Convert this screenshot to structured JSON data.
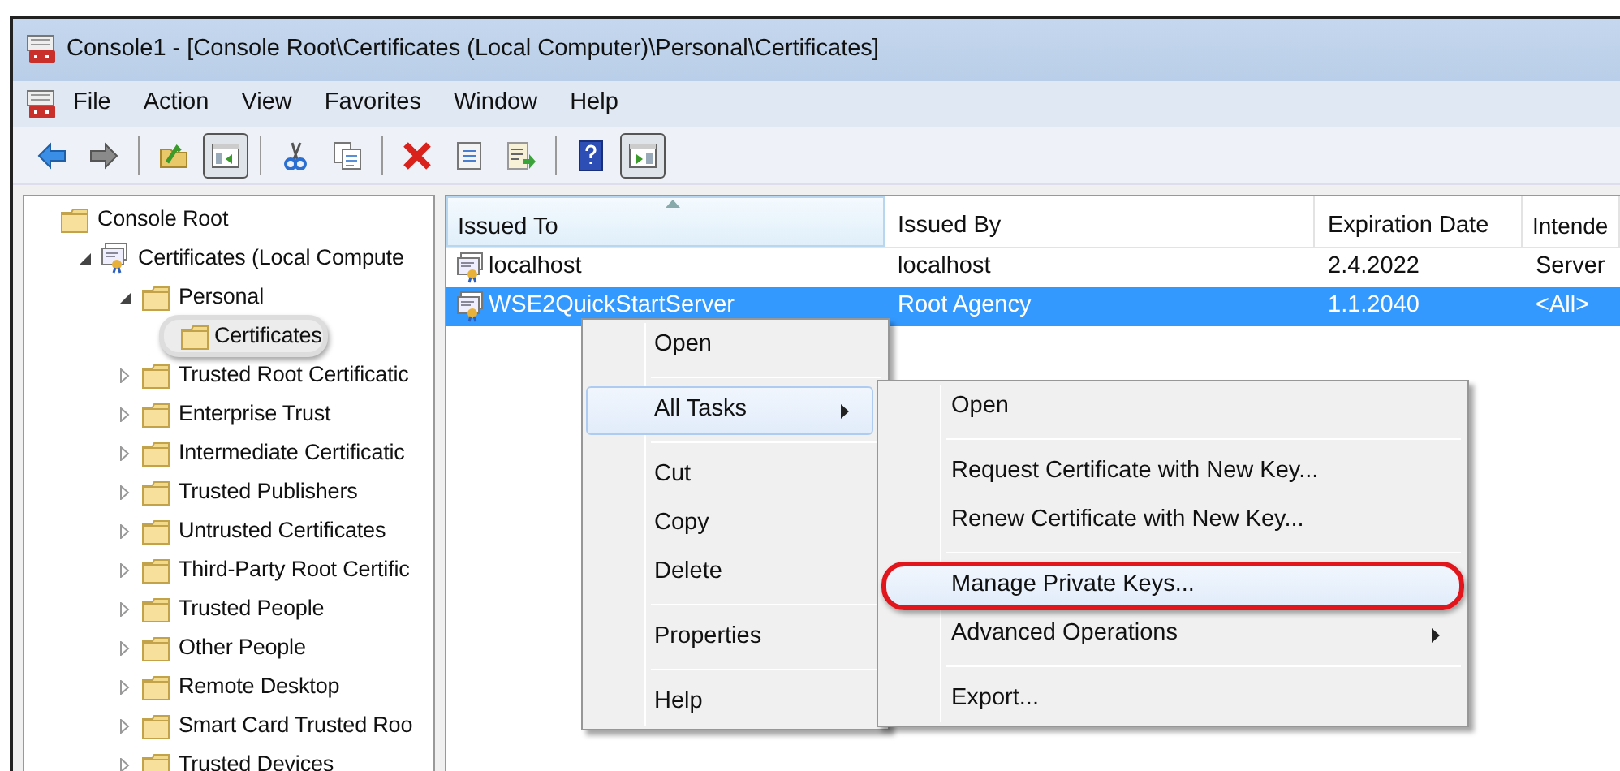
{
  "window": {
    "title": "Console1 - [Console Root\\Certificates (Local Computer)\\Personal\\Certificates]"
  },
  "menu_bar": [
    "File",
    "Action",
    "View",
    "Favorites",
    "Window",
    "Help"
  ],
  "toolbar": [
    {
      "kind": "back",
      "pressed": false
    },
    {
      "kind": "forward",
      "pressed": false
    },
    {
      "kind": "separator"
    },
    {
      "kind": "up",
      "pressed": false
    },
    {
      "kind": "tree",
      "pressed": true
    },
    {
      "kind": "separator"
    },
    {
      "kind": "cut",
      "pressed": false
    },
    {
      "kind": "copy",
      "pressed": false
    },
    {
      "kind": "separator"
    },
    {
      "kind": "delete",
      "pressed": false
    },
    {
      "kind": "properties",
      "pressed": false
    },
    {
      "kind": "export",
      "pressed": false
    },
    {
      "kind": "separator"
    },
    {
      "kind": "help",
      "pressed": false
    },
    {
      "kind": "actionpane",
      "pressed": true
    }
  ],
  "tree": [
    {
      "label": "Console Root",
      "kind": "folder",
      "children": [
        {
          "label": "Certificates (Local Compute",
          "kind": "certificate",
          "expanded": true,
          "children": [
            {
              "label": "Personal",
              "kind": "folder",
              "expanded": true,
              "children": [
                {
                  "label": "Certificates",
                  "kind": "folder",
                  "selected": true,
                  "annotated": true
                }
              ]
            },
            {
              "label": "Trusted Root Certificatic",
              "kind": "folder",
              "expanded": false
            },
            {
              "label": "Enterprise Trust",
              "kind": "folder",
              "expanded": false
            },
            {
              "label": "Intermediate Certificatic",
              "kind": "folder",
              "expanded": false
            },
            {
              "label": "Trusted Publishers",
              "kind": "folder",
              "expanded": false
            },
            {
              "label": "Untrusted Certificates",
              "kind": "folder",
              "expanded": false
            },
            {
              "label": "Third-Party Root Certific",
              "kind": "folder",
              "expanded": false
            },
            {
              "label": "Trusted People",
              "kind": "folder",
              "expanded": false
            },
            {
              "label": "Other People",
              "kind": "folder",
              "expanded": false
            },
            {
              "label": "Remote Desktop",
              "kind": "folder",
              "expanded": false
            },
            {
              "label": "Smart Card Trusted Roo",
              "kind": "folder",
              "expanded": false
            },
            {
              "label": "Trusted Devices",
              "kind": "folder",
              "expanded": false
            }
          ]
        }
      ]
    }
  ],
  "table": {
    "columns": [
      {
        "label": "Issued To",
        "sorted": true
      },
      {
        "label": "Issued By",
        "sorted": false
      },
      {
        "label": "Expiration Date",
        "sorted": false
      },
      {
        "label": "Intende",
        "sorted": false
      }
    ],
    "rows": [
      {
        "cells": [
          "localhost",
          "localhost",
          "2.4.2022",
          "Server"
        ],
        "selected": false
      },
      {
        "cells": [
          "WSE2QuickStartServer",
          "Root Agency",
          "1.1.2040",
          "<All>"
        ],
        "selected": true
      }
    ]
  },
  "context_menu": [
    {
      "kind": "item",
      "label": "Open",
      "highlighted": false
    },
    {
      "kind": "separator"
    },
    {
      "kind": "item",
      "label": "All Tasks",
      "submenu": true,
      "highlighted": true
    },
    {
      "kind": "separator"
    },
    {
      "kind": "item",
      "label": "Cut",
      "highlighted": false
    },
    {
      "kind": "item",
      "label": "Copy",
      "highlighted": false
    },
    {
      "kind": "item",
      "label": "Delete",
      "highlighted": false
    },
    {
      "kind": "separator"
    },
    {
      "kind": "item",
      "label": "Properties",
      "highlighted": false
    },
    {
      "kind": "separator"
    },
    {
      "kind": "item",
      "label": "Help",
      "highlighted": false
    }
  ],
  "submenu": [
    {
      "kind": "item",
      "label": "Open",
      "highlighted": false
    },
    {
      "kind": "separator"
    },
    {
      "kind": "item",
      "label": "Request Certificate with New Key...",
      "highlighted": false
    },
    {
      "kind": "item",
      "label": "Renew Certificate with New Key...",
      "highlighted": false
    },
    {
      "kind": "separator"
    },
    {
      "kind": "item",
      "label": "Manage Private Keys...",
      "highlighted": true,
      "annotated": true
    },
    {
      "kind": "item",
      "label": "Advanced Operations",
      "submenu": true,
      "highlighted": false
    },
    {
      "kind": "separator"
    },
    {
      "kind": "item",
      "label": "Export...",
      "highlighted": false
    }
  ]
}
